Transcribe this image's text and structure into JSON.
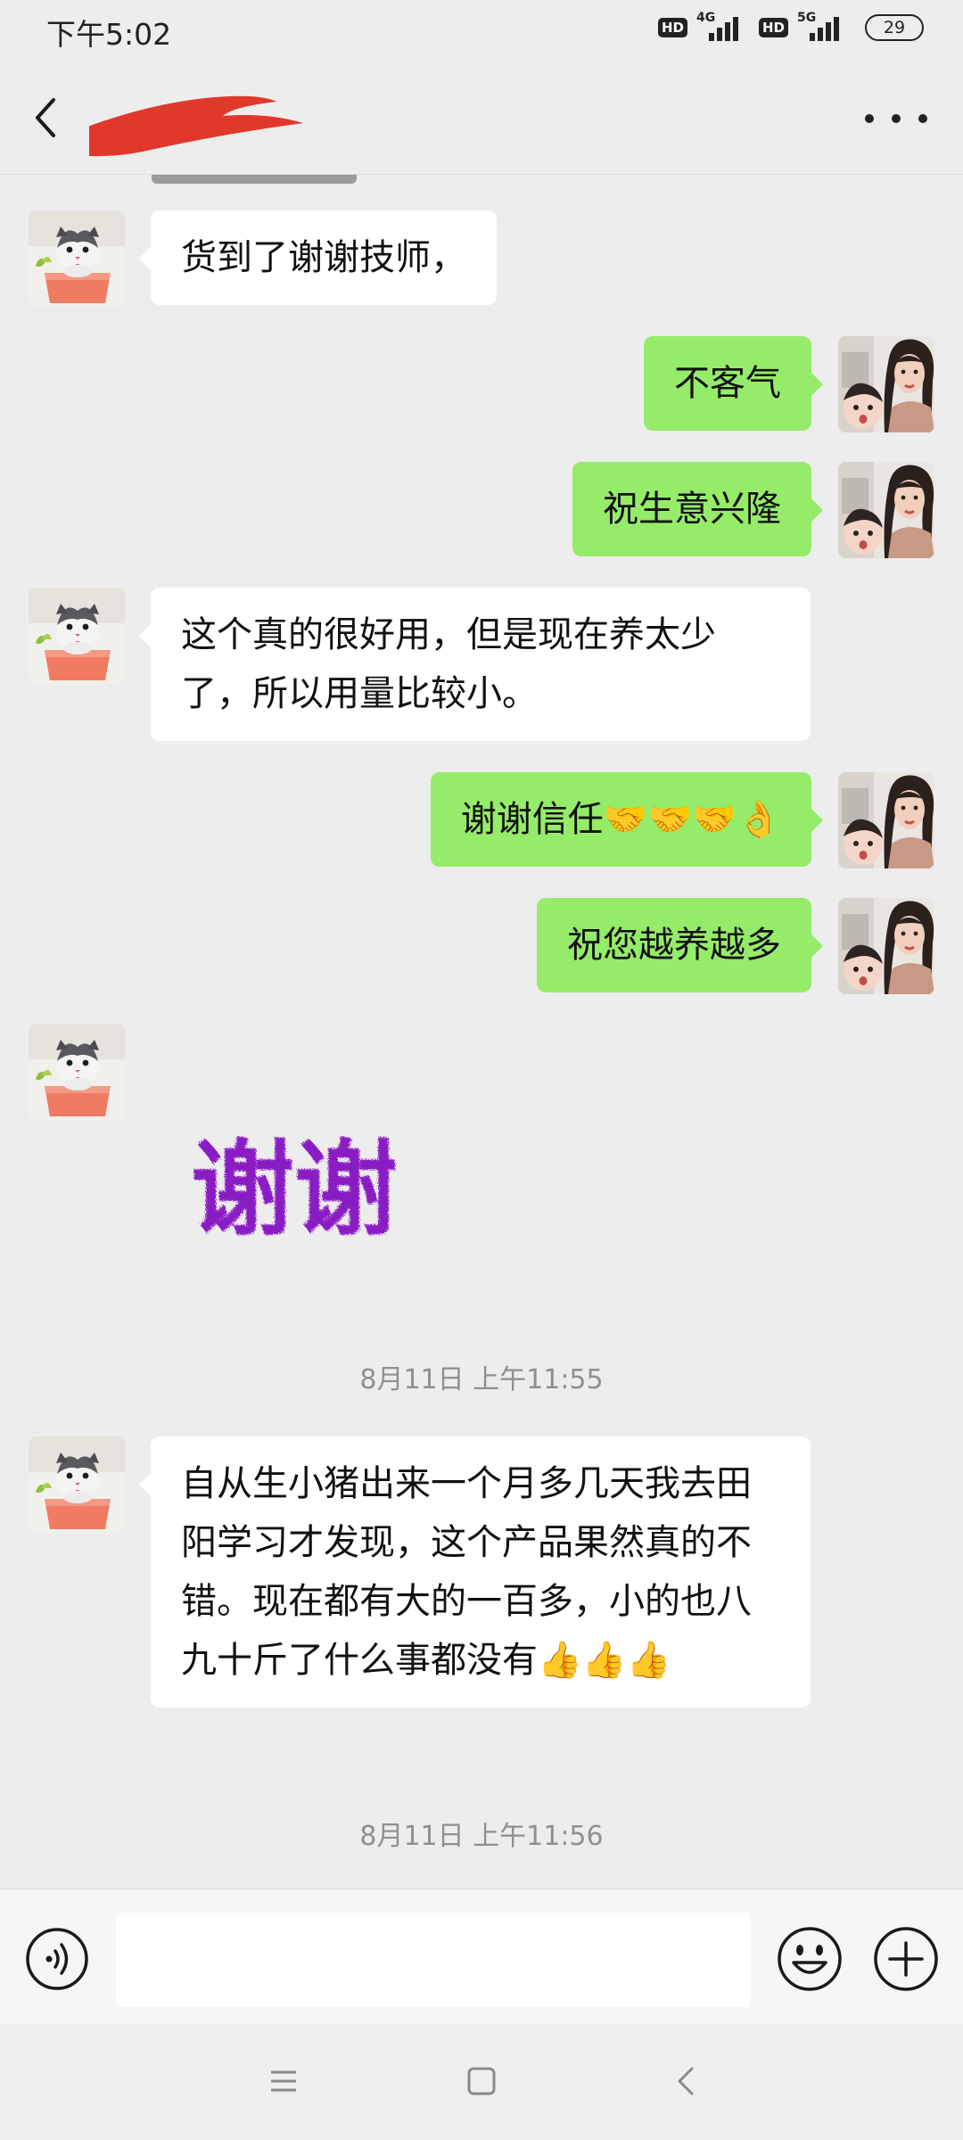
{
  "status_bar": {
    "time": "下午5:02",
    "hd1": "HD",
    "net1": "4G",
    "hd2": "HD",
    "net2": "5G",
    "battery": "29"
  },
  "header": {
    "back_icon": "chevron-left-icon",
    "more_icon": "more-dots-icon"
  },
  "messages": [
    {
      "side": "left",
      "text": "货到了谢谢技师，"
    },
    {
      "side": "right",
      "text": "不客气"
    },
    {
      "side": "right",
      "text": "祝生意兴隆"
    },
    {
      "side": "left",
      "text": "这个真的很好用，但是现在养太少了，所以用量比较小。"
    },
    {
      "side": "right",
      "text": "谢谢信任🤝🤝🤝👌"
    },
    {
      "side": "right",
      "text": "祝您越养越多"
    },
    {
      "side": "left",
      "type": "sticker",
      "sticker_text": "谢谢"
    },
    {
      "type": "timestamp",
      "text": "8月11日 上午11:55"
    },
    {
      "side": "left",
      "text": "自从生小猪出来一个月多几天我去田阳学习才发现，这个产品果然真的不错。现在都有大的一百多，小的也八九十斤了什么事都没有👍👍👍"
    },
    {
      "type": "timestamp",
      "text": "8月11日 上午11:56"
    }
  ],
  "input_bar": {
    "voice_icon": "voice-icon",
    "text_value": "",
    "emoji_icon": "emoji-icon",
    "plus_icon": "plus-icon"
  },
  "nav_bar": {
    "menu_icon": "menu-icon",
    "home_icon": "home-icon",
    "back_icon": "back-icon"
  },
  "colors": {
    "background": "#ededed",
    "sent_bubble": "#95ec69",
    "received_bubble": "#ffffff",
    "timestamp_text": "#8f8f8f",
    "sticker": "#8a1cc4"
  }
}
